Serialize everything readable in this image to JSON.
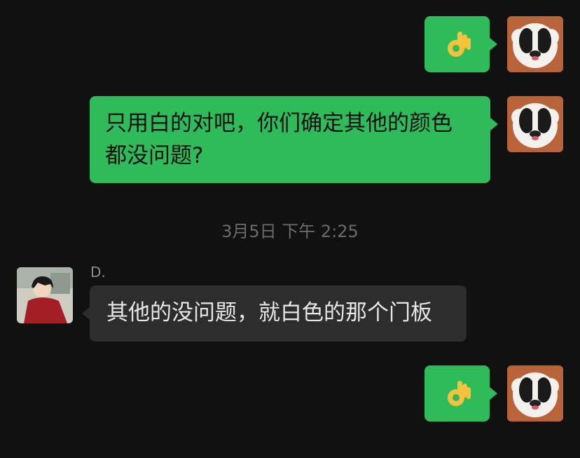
{
  "messages": [
    {
      "side": "right",
      "type": "emoji",
      "emoji_name": "ok-hand"
    },
    {
      "side": "right",
      "type": "text",
      "text_line1": "只用白的对吧，你们确定其他的颜色",
      "text_line2": "都没问题?"
    },
    {
      "type": "timestamp",
      "text": "3月5日 下午 2:25"
    },
    {
      "side": "left",
      "type": "text",
      "sender": "D.",
      "text": "其他的没问题，就白色的那个门板"
    },
    {
      "side": "right",
      "type": "emoji",
      "emoji_name": "ok-hand"
    }
  ],
  "colors": {
    "background": "#111111",
    "outgoing_bubble": "#2fbb5a",
    "incoming_bubble": "#2d2d2d",
    "timestamp_text": "#6b6b6b"
  },
  "icons": {
    "self_avatar": "dog-avatar",
    "contact_avatar": "anime-character-avatar",
    "emoji": "ok-hand-icon"
  }
}
